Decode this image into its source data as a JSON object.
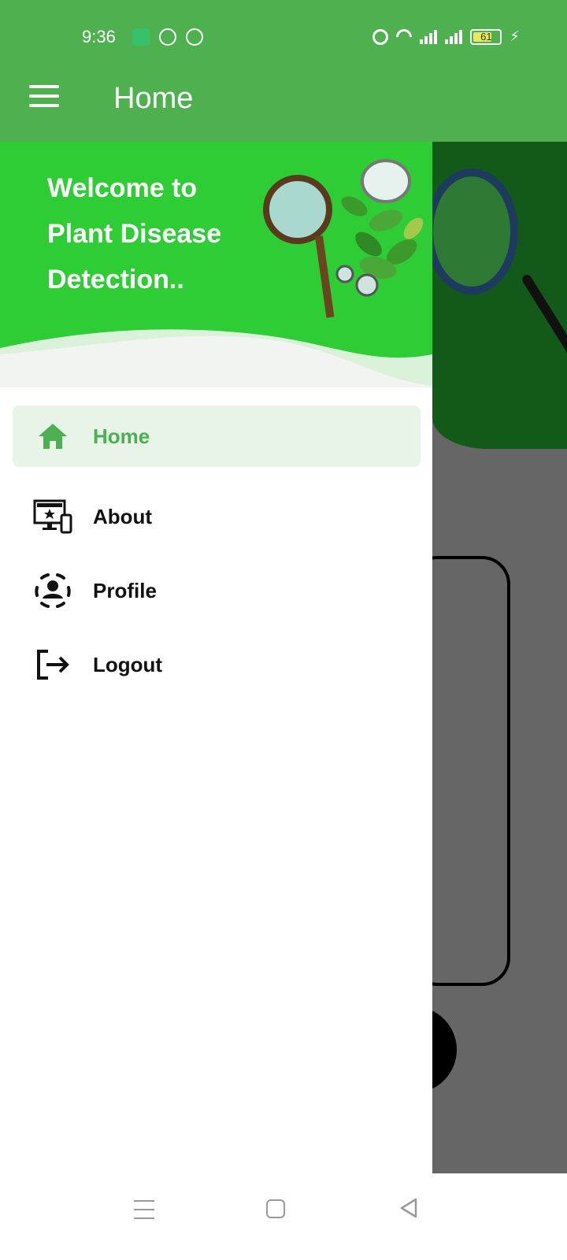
{
  "status_bar": {
    "time": "9:36",
    "battery_level": "61",
    "icons": [
      "app-icon",
      "bus-icon",
      "chrome-icon",
      "alarm-icon",
      "wifi-icon",
      "volte-icon",
      "signal-icon",
      "signal-icon",
      "battery-icon",
      "charging-icon"
    ]
  },
  "app_bar": {
    "title": "Home",
    "menu_icon": "hamburger-menu-icon"
  },
  "drawer": {
    "header": {
      "welcome_line1": "Welcome to",
      "welcome_line2": "Plant Disease",
      "welcome_line3": "Detection.."
    },
    "items": [
      {
        "label": "Home",
        "icon": "home-icon",
        "active": true
      },
      {
        "label": "About",
        "icon": "devices-icon",
        "active": false
      },
      {
        "label": "Profile",
        "icon": "profile-icon",
        "active": false
      },
      {
        "label": "Logout",
        "icon": "logout-icon",
        "active": false
      }
    ]
  },
  "nav_bar": {
    "buttons": [
      "recents-icon",
      "home-square-icon",
      "back-triangle-icon"
    ]
  },
  "colors": {
    "app_bar": "#4fb04f",
    "drawer_header": "#2ecc35",
    "active_item_bg": "#e8f4e8",
    "active_item_text": "#4caf50"
  }
}
